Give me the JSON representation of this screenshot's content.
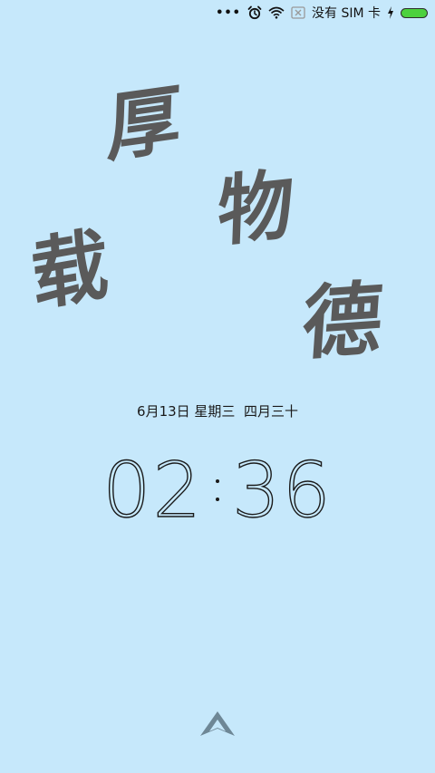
{
  "status_bar": {
    "dots": "•••",
    "carrier": "没有 SIM 卡",
    "icons": [
      "more-dots-icon",
      "alarm-icon",
      "wifi-icon",
      "no-sim-icon",
      "charging-icon",
      "battery-icon"
    ],
    "battery_level": 1.0,
    "battery_color": "#4cd13e"
  },
  "calligraphy": {
    "chars": [
      "厚",
      "物",
      "载",
      "德"
    ]
  },
  "date_line": "6月13日 星期三  四月三十",
  "clock": {
    "hour": "02",
    "minute": "36"
  },
  "colors": {
    "background": "#c6e8fb",
    "calligraphy": "#5a5a5a",
    "text": "#1a1a1a",
    "arrow": "#6e8796"
  }
}
